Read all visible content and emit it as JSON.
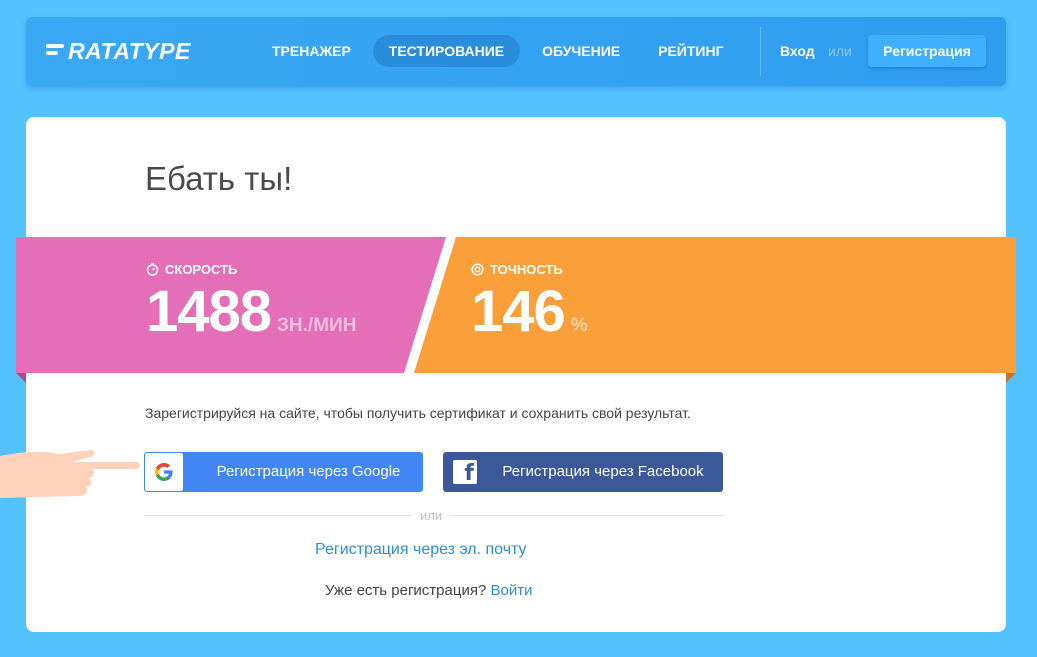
{
  "header": {
    "logo_text": "RATATYPE",
    "nav": [
      {
        "label": "ТРЕНАЖЕР",
        "active": false
      },
      {
        "label": "ТЕСТИРОВАНИЕ",
        "active": true
      },
      {
        "label": "ОБУЧЕНИЕ",
        "active": false
      },
      {
        "label": "РЕЙТИНГ",
        "active": false
      }
    ],
    "login_label": "Вход",
    "or_label": "или",
    "register_label": "Регистрация"
  },
  "result": {
    "title": "Ебать ты!",
    "speed": {
      "label": "СКОРОСТЬ",
      "value": "1488",
      "unit": "ЗН./МИН",
      "icon": "stopwatch-icon",
      "color": "#e46fb8"
    },
    "accuracy": {
      "label": "ТОЧНОСТЬ",
      "value": "146",
      "unit": "%",
      "icon": "target-icon",
      "color": "#fa9f3a"
    }
  },
  "signup": {
    "prompt": "Зарегистрируйся на сайте, чтобы получить сертификат и сохранить свой результат.",
    "google_label": "Регистрация через Google",
    "facebook_label": "Регистрация через Facebook",
    "or_label": "или",
    "email_label": "Регистрация через эл. почту",
    "have_account": "Уже есть регистрация?",
    "login_link": "Войти"
  },
  "colors": {
    "background": "#54c2ff",
    "google": "#4285f4",
    "facebook": "#3b5998",
    "link": "#2a8fd6"
  }
}
